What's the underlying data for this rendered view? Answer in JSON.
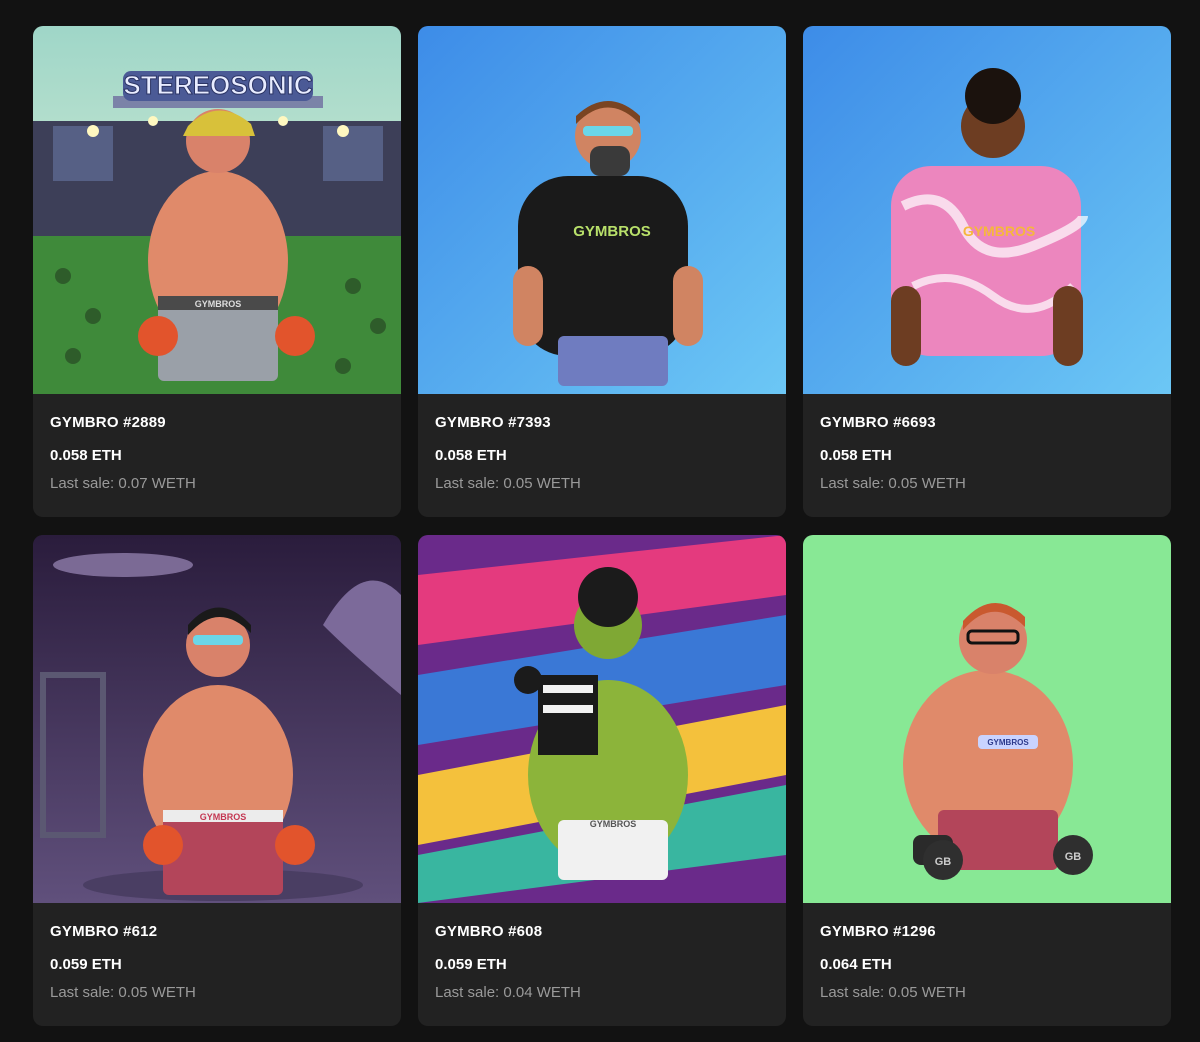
{
  "items": [
    {
      "name": "GYMBRO #2889",
      "price": "0.058 ETH",
      "last_sale": "Last sale: 0.07 WETH",
      "art_text": "STEREOSONIC",
      "short_text": "GYMBROS"
    },
    {
      "name": "GYMBRO #7393",
      "price": "0.058 ETH",
      "last_sale": "Last sale: 0.05 WETH",
      "art_text": "GYMBROS"
    },
    {
      "name": "GYMBRO #6693",
      "price": "0.058 ETH",
      "last_sale": "Last sale: 0.05 WETH",
      "art_text": "GYMBROS"
    },
    {
      "name": "GYMBRO #612",
      "price": "0.059 ETH",
      "last_sale": "Last sale: 0.05 WETH",
      "art_text": "GYMBROS"
    },
    {
      "name": "GYMBRO #608",
      "price": "0.059 ETH",
      "last_sale": "Last sale: 0.04 WETH",
      "art_text": "GYMBROS"
    },
    {
      "name": "GYMBRO #1296",
      "price": "0.064 ETH",
      "last_sale": "Last sale: 0.05 WETH",
      "art_text": "GYMBROS",
      "dumbbell_text": "GB"
    }
  ],
  "colors": {
    "page_bg": "#121212",
    "card_bg": "#222222",
    "muted_text": "#9a9a9a"
  }
}
